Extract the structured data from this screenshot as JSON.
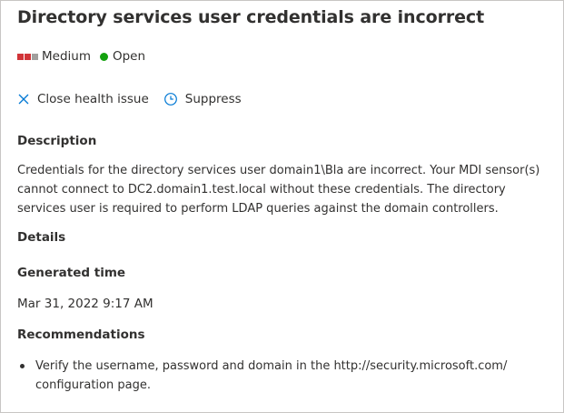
{
  "title": "Directory services user credentials are incorrect",
  "severity": {
    "label": "Medium",
    "icon": "severity-bars-icon",
    "colors": [
      "#d13438",
      "#d13438",
      "#a19f9d"
    ]
  },
  "status": {
    "label": "Open",
    "icon": "status-dot-icon",
    "color": "#13a10e"
  },
  "actions": {
    "close_label": "Close health issue",
    "close_icon": "close-icon",
    "suppress_label": "Suppress",
    "suppress_icon": "clock-icon",
    "icon_color": "#0078d4"
  },
  "description": {
    "heading": "Description",
    "text": "Credentials for the directory services user domain1\\Bla are incorrect. Your MDI sensor(s) cannot connect to DC2.domain1.test.local without these credentials. The directory services user is required to perform LDAP queries against the domain controllers."
  },
  "details": {
    "heading": "Details",
    "generated_heading": "Generated time",
    "generated_value": "Mar 31, 2022 9:17 AM"
  },
  "recommendations": {
    "heading": "Recommendations",
    "items": [
      "Verify the username, password and domain in the http://security.microsoft.com/ configuration page."
    ]
  }
}
